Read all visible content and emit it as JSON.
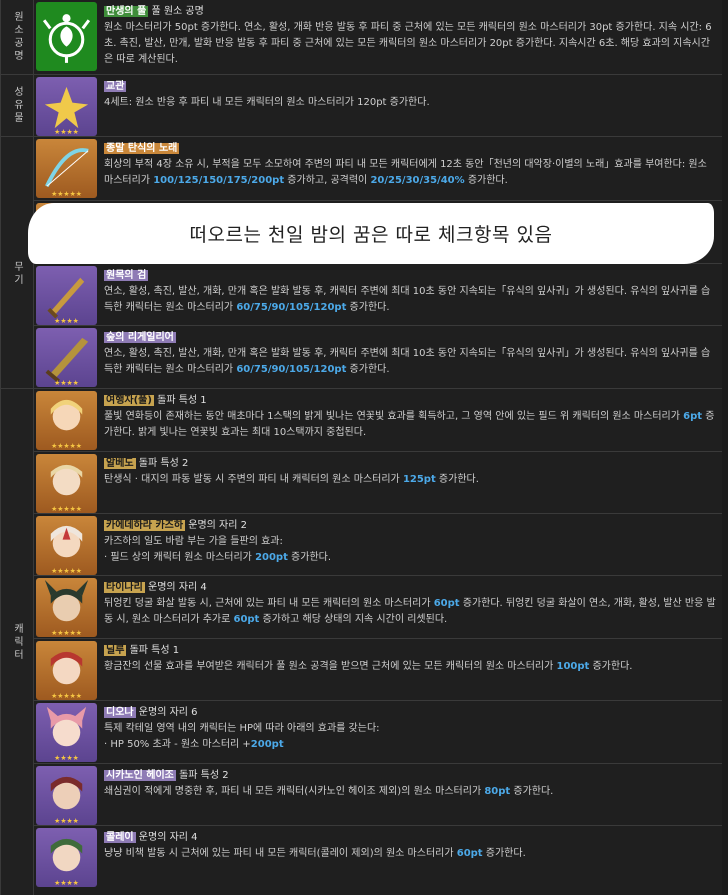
{
  "categories": [
    {
      "label": "원소공명"
    },
    {
      "label": "성유물"
    },
    {
      "label": "무기"
    },
    {
      "label": "캐릭터"
    }
  ],
  "banner": {
    "text": "떠오르는 천일 밤의 꿈은 따로 체크항목 있음"
  },
  "rows": [
    {
      "name": "만생의 풀",
      "suffix": " 풀 원소 공명",
      "desc": "원소 마스터리가 50pt 증가한다. 연소, 활성, 개화 반응 발동 후 파티 중 근처에 있는 모든 캐릭터의 원소 마스터리가 30pt 증가한다. 지속 시간: 6초. 촉진, 발산, 만개, 발화 반응 발동 후 파티 중 근처에 있는 모든 캐릭터의 원소 마스터리가 20pt 증가한다. 지속시간 6초. 해당 효과의 지속시간은 따로 계산된다."
    },
    {
      "name": "교관",
      "suffix": "",
      "desc": "4세트: 원소 반응 후 파티 내 모든 캐릭터의 원소 마스터리가 120pt 증가한다."
    },
    {
      "name": "종말 탄식의 노래",
      "suffix": "",
      "desc_a": "회상의 부적 4장 소유 시, 부적을 모두 소모하여 주변의 파티 내 모든 캐릭터에게 12초 동안「천년의 대악장·이별의 노래」효과를 부여한다: 원소 마스터리가 ",
      "value_a": "100/125/150/175/200pt",
      "desc_b": " 증가하고, 공격력이 ",
      "value_b": "20/25/30/35/40%",
      "desc_c": " 증가한다."
    },
    {
      "name": "원목의 검",
      "suffix": "",
      "desc_a": "연소, 활성, 촉진, 발산, 개화, 만개 혹은 발화 발동 후, 캐릭터 주변에 최대 10초 동안 지속되는「유식의 잎사귀」가 생성된다. 유식의 잎사귀를 습득한 캐릭터는 원소 마스터리가 ",
      "value_a": "60/75/90/105/120pt",
      "desc_b": " 증가한다."
    },
    {
      "name": "숲의 리게일리어",
      "suffix": "",
      "desc_a": "연소, 활성, 촉진, 발산, 개화, 만개 혹은 발화 발동 후, 캐릭터 주변에 최대 10초 동안 지속되는「유식의 잎사귀」가 생성된다. 유식의 잎사귀를 습득한 캐릭터는 원소 마스터리가 ",
      "value_a": "60/75/90/105/120pt",
      "desc_b": " 증가한다."
    },
    {
      "name": "여행자(풀)",
      "suffix": " 돌파 특성 1",
      "desc_a": "풀빛 연화등이 존재하는 동안 매초마다 1스택의 밝게 빛나는 연꽃빛 효과를 획득하고, 그 영역 안에 있는 필드 위 캐릭터의 원소 마스터리가 ",
      "value_a": "6pt",
      "desc_b": " 증가한다. 밝게 빛나는 연꽃빛 효과는 최대 10스택까지 중첩된다."
    },
    {
      "name": "알베도",
      "suffix": " 돌파 특성 2",
      "desc_a": "탄생식 · 대지의 파동 발동 시 주변의 파티 내 캐릭터의 원소 마스터리가 ",
      "value_a": "125pt",
      "desc_b": " 증가한다."
    },
    {
      "name": "카에데하라 카즈하",
      "suffix": " 운명의 자리 2",
      "desc_a": "카즈하의 일도 바람 부는 가을 들판의 효과:",
      "desc_b": "· 필드 상의 캐릭터 원소 마스터리가 ",
      "value_a": "200pt",
      "desc_c": " 증가한다."
    },
    {
      "name": "타이나리",
      "suffix": " 운명의 자리 4",
      "desc_a": "뒤엉킨 덩굴 화살 발동 시, 근처에 있는 파티 내 모든 캐릭터의 원소 마스터리가 ",
      "value_a": "60pt",
      "desc_b": " 증가한다. 뒤엉킨 덩굴 화살이 연소, 개화, 활성, 발산 반응 발동 시, 원소 마스터리가 추가로 ",
      "value_b": "60pt",
      "desc_c": " 증가하고 해당 상태의 지속 시간이 리셋된다."
    },
    {
      "name": "닐루",
      "suffix": " 돌파 특성 1",
      "desc_a": "황금잔의 선물 효과를 부여받은 캐릭터가 풀 원소 공격을 받으면 근처에 있는 모든 캐릭터의 원소 마스터리가 ",
      "value_a": "100pt",
      "desc_b": " 증가한다."
    },
    {
      "name": "디오나",
      "suffix": " 운명의 자리 6",
      "desc_a": "특제 칵테일 영역 내의 캐릭터는 HP에 따라 아래의 효과를 갖는다:",
      "desc_b": "· HP 50% 초과 - 원소 마스터리 +",
      "value_a": "200pt"
    },
    {
      "name": "시카노인 헤이조",
      "suffix": " 돌파 특성 2",
      "desc_a": "쇄심권이 적에게 명중한 후, 파티 내 모든 캐릭터(시카노인 헤이조 제외)의 원소 마스터리가 ",
      "value_a": "80pt",
      "desc_b": " 증가한다."
    },
    {
      "name": "콜레이",
      "suffix": " 운명의 자리 4",
      "desc_a": "냥냥 비책 발동 시 근처에 있는 파티 내 모든 캐릭터(콜레이 제외)의 원소 마스터리가 ",
      "value_a": "60pt",
      "desc_b": " 증가한다."
    }
  ]
}
